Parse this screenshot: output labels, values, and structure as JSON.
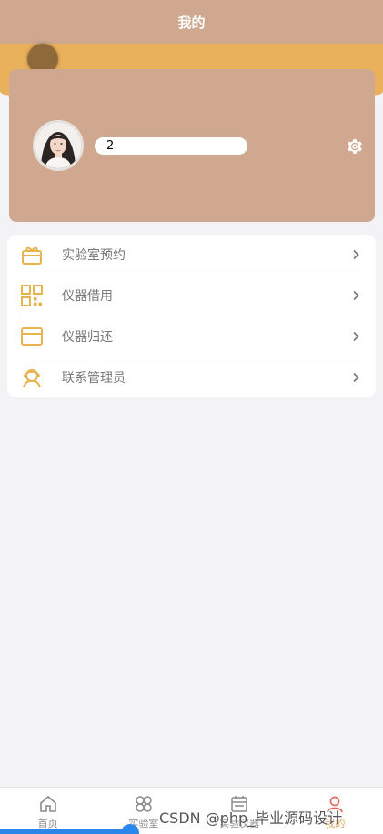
{
  "header": {
    "title": "我的"
  },
  "profile": {
    "username": "2"
  },
  "menu": {
    "items": [
      {
        "label": "实验室预约",
        "icon": "gift-icon"
      },
      {
        "label": "仪器借用",
        "icon": "grid-icon"
      },
      {
        "label": "仪器归还",
        "icon": "card-icon"
      },
      {
        "label": "联系管理员",
        "icon": "support-agent-icon"
      }
    ]
  },
  "bottom_nav": {
    "items": [
      {
        "label": "首页",
        "icon": "home-icon"
      },
      {
        "label": "实验室",
        "icon": "clover-icon"
      },
      {
        "label": "实验仪器",
        "icon": "calendar-icon"
      },
      {
        "label": "我的",
        "icon": "user-icon"
      }
    ],
    "active_index": 3
  },
  "watermark": "CSDN @php_毕业源码设计",
  "colors": {
    "header": "#cfa88f",
    "band": "#eab15c",
    "icon_accent": "#e6b34e",
    "active_nav": "#e0a860"
  }
}
